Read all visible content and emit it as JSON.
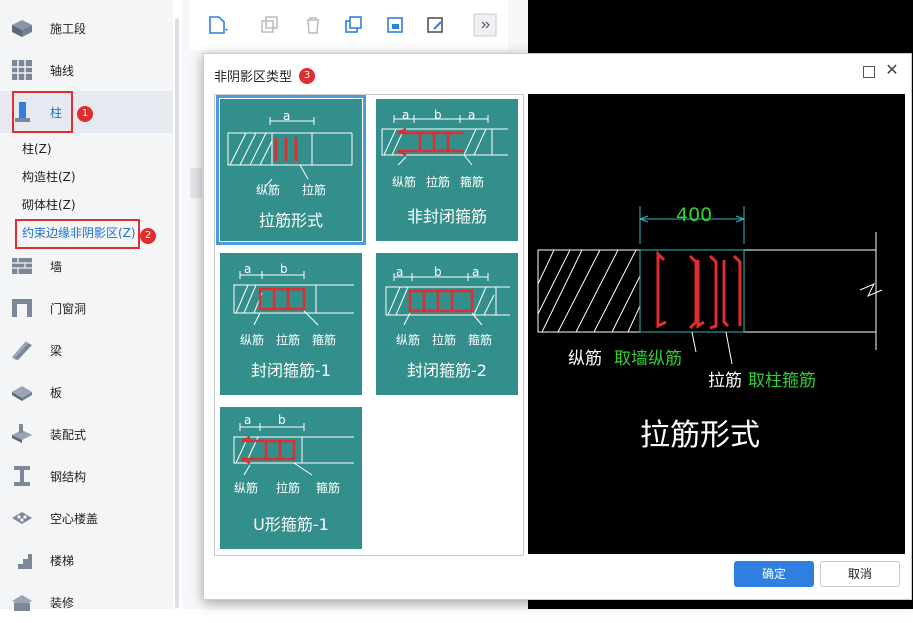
{
  "sidebar": {
    "items": [
      {
        "label": "施工段",
        "icon": "segment-icon"
      },
      {
        "label": "轴线",
        "icon": "grid-axis-icon"
      },
      {
        "label": "柱",
        "icon": "column-icon"
      },
      {
        "label": "墙",
        "icon": "wall-icon"
      },
      {
        "label": "门窗洞",
        "icon": "door-window-icon"
      },
      {
        "label": "梁",
        "icon": "beam-icon"
      },
      {
        "label": "板",
        "icon": "slab-icon"
      },
      {
        "label": "装配式",
        "icon": "prefab-icon"
      },
      {
        "label": "钢结构",
        "icon": "steel-structure-icon"
      },
      {
        "label": "空心楼盖",
        "icon": "hollow-floor-icon"
      },
      {
        "label": "楼梯",
        "icon": "stair-icon"
      },
      {
        "label": "装修",
        "icon": "decoration-icon"
      }
    ],
    "sub_items": [
      "柱(Z)",
      "构造柱(Z)",
      "砌体柱(Z)",
      "约束边缘非阴影区(Z)"
    ]
  },
  "badges": [
    "1",
    "2",
    "3"
  ],
  "dialog": {
    "title": "非阴影区类型",
    "options": [
      {
        "caption": "拉筋形式",
        "labels": [
          "纵筋",
          "拉筋"
        ],
        "dims": [
          "a"
        ]
      },
      {
        "caption": "非封闭箍筋",
        "labels": [
          "纵筋",
          "拉筋",
          "箍筋"
        ],
        "dims": [
          "a",
          "b",
          "a"
        ]
      },
      {
        "caption": "封闭箍筋-1",
        "labels": [
          "纵筋",
          "拉筋",
          "箍筋"
        ],
        "dims": [
          "a",
          "b"
        ]
      },
      {
        "caption": "封闭箍筋-2",
        "labels": [
          "纵筋",
          "拉筋",
          "箍筋"
        ],
        "dims": [
          "a",
          "b",
          "a"
        ]
      },
      {
        "caption": "U形箍筋-1",
        "labels": [
          "纵筋",
          "拉筋",
          "箍筋"
        ],
        "dims": [
          "a",
          "b"
        ]
      }
    ],
    "preview": {
      "dimension": "400",
      "label1_white": "纵筋",
      "label1_green": "取墙纵筋",
      "label2_white": "拉筋",
      "label2_green": "取柱箍筋",
      "caption": "拉筋形式"
    },
    "ok_label": "确定",
    "cancel_label": "取消"
  },
  "colors": {
    "accent": "#1c6fd1",
    "teal": "#338f8c",
    "highlight": "#e02d2d",
    "green_text": "#2fd12f"
  }
}
